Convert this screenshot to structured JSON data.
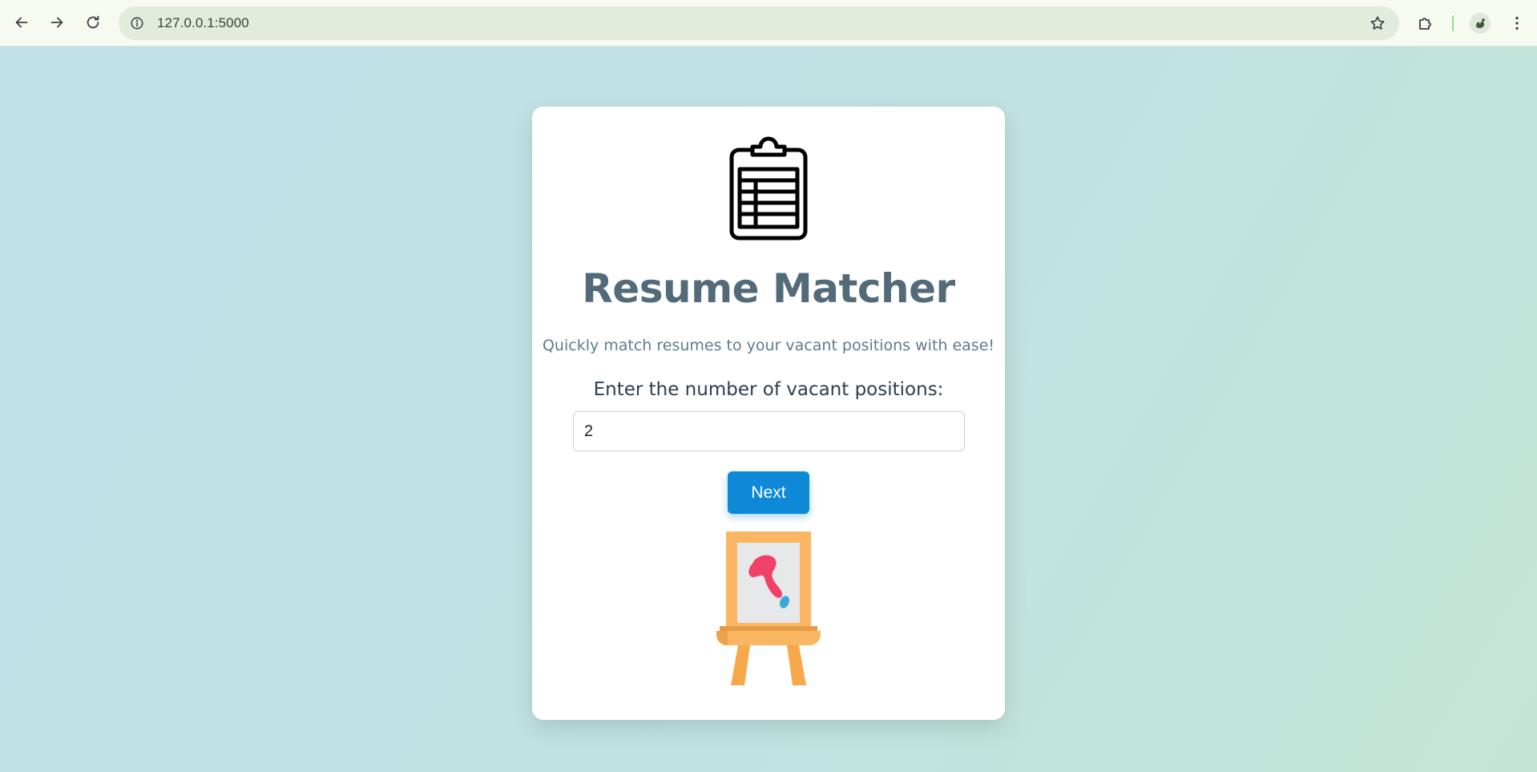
{
  "browser": {
    "url": "127.0.0.1:5000"
  },
  "page": {
    "title": "Resume Matcher",
    "subtitle": "Quickly match resumes to your vacant positions with ease!",
    "positions_label": "Enter the number of vacant positions:",
    "positions_value": "2",
    "next_label": "Next"
  },
  "icons": {
    "header_icon": "clipboard-table-icon",
    "footer_illustration": "easel-painting-icon"
  },
  "colors": {
    "title": "#536b79",
    "subtitle": "#5f7c8a",
    "button": "#0d89d7",
    "background": "#c2e2e4"
  }
}
